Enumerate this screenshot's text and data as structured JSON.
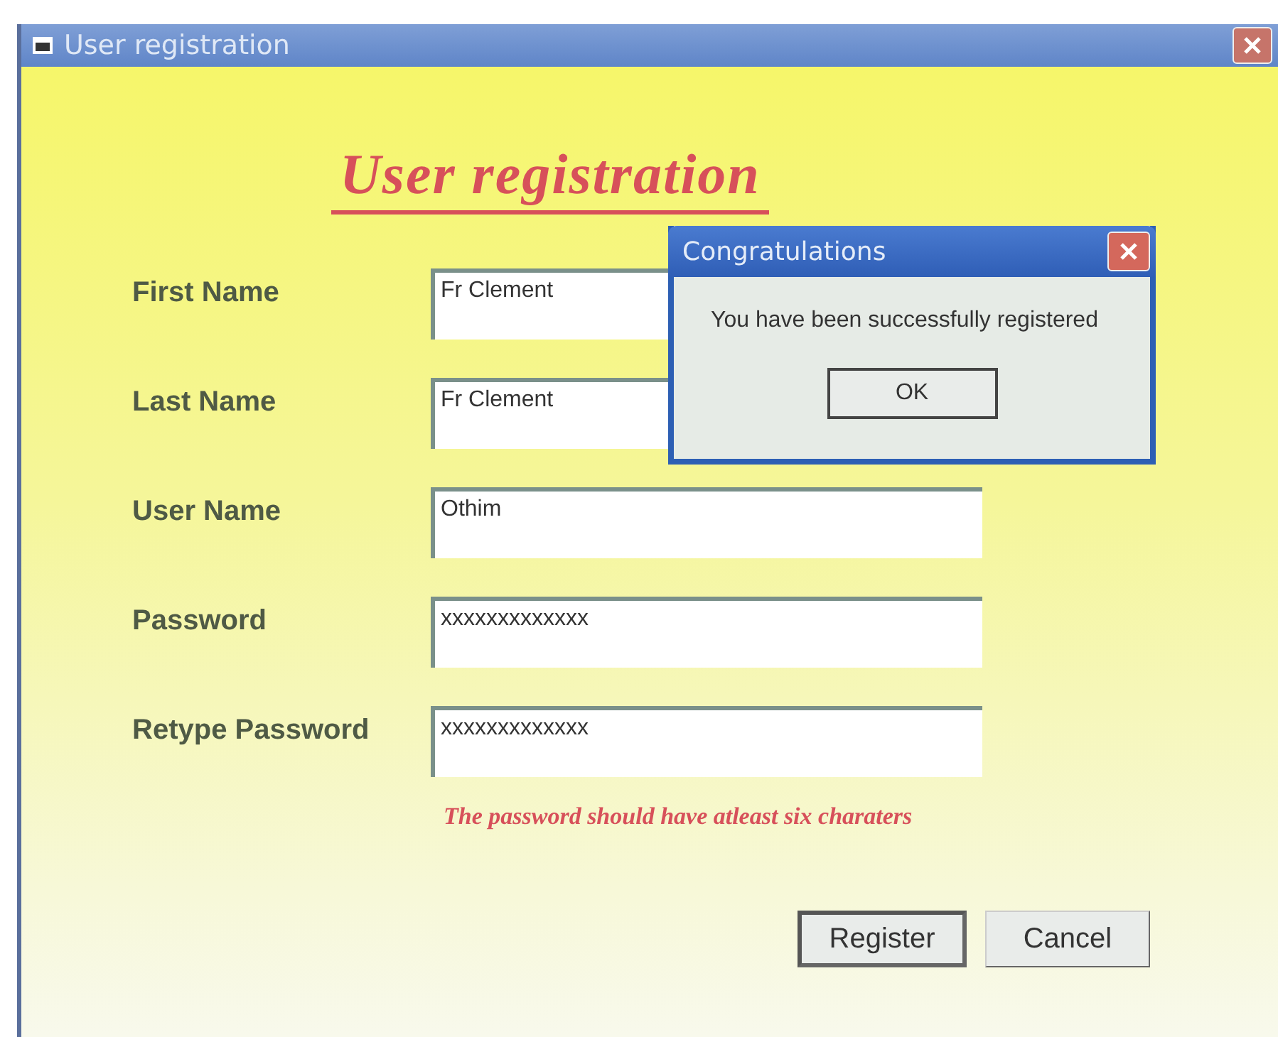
{
  "window": {
    "title": "User registration"
  },
  "heading": "User registration",
  "fields": [
    {
      "label": "First Name",
      "value": "Fr Clement"
    },
    {
      "label": "Last Name",
      "value": "Fr Clement"
    },
    {
      "label": "User Name",
      "value": "Othim"
    },
    {
      "label": "Password",
      "value": "xxxxxxxxxxxxx"
    },
    {
      "label": "Retype Password",
      "value": "xxxxxxxxxxxxx"
    }
  ],
  "hint": "The password should have atleast six charaters",
  "buttons": [
    {
      "label": "Register",
      "default": true
    },
    {
      "label": "Cancel",
      "default": false
    }
  ],
  "dialog": {
    "title": "Congratulations",
    "message": "You have been successfully registered",
    "button": "OK"
  }
}
